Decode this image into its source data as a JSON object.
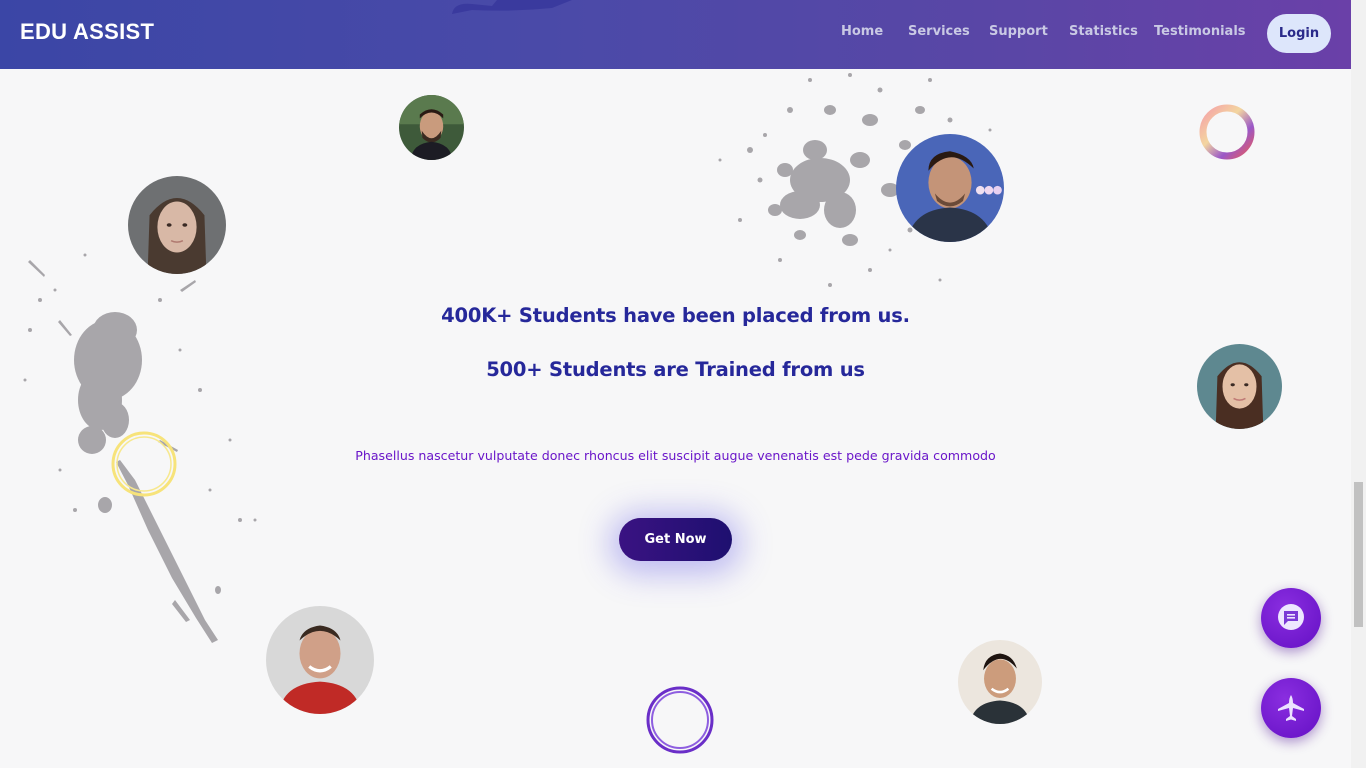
{
  "header": {
    "brand": "EDU ASSIST",
    "nav": [
      "Home",
      "Services",
      "Support",
      "Statistics",
      "Testimonials"
    ],
    "login_label": "Login"
  },
  "hero": {
    "headline_1": "400K+ Students have been placed from us.",
    "headline_2": "500+ Students are Trained from us",
    "subtext": "Phasellus nascetur vulputate donec rhoncus elit suscipit augue venenatis est pede gravida commodo",
    "cta_label": "Get Now"
  },
  "floating_buttons": {
    "chat_icon": "chat-bubble-icon",
    "rocket_icon": "jet-plane-icon"
  },
  "colors": {
    "header_gradient_start": "#3b46a6",
    "header_gradient_end": "#6a40a8",
    "headline": "#26289a",
    "subtext": "#6a16c9",
    "cta": "#2a1078",
    "fab": "#7420d0"
  }
}
